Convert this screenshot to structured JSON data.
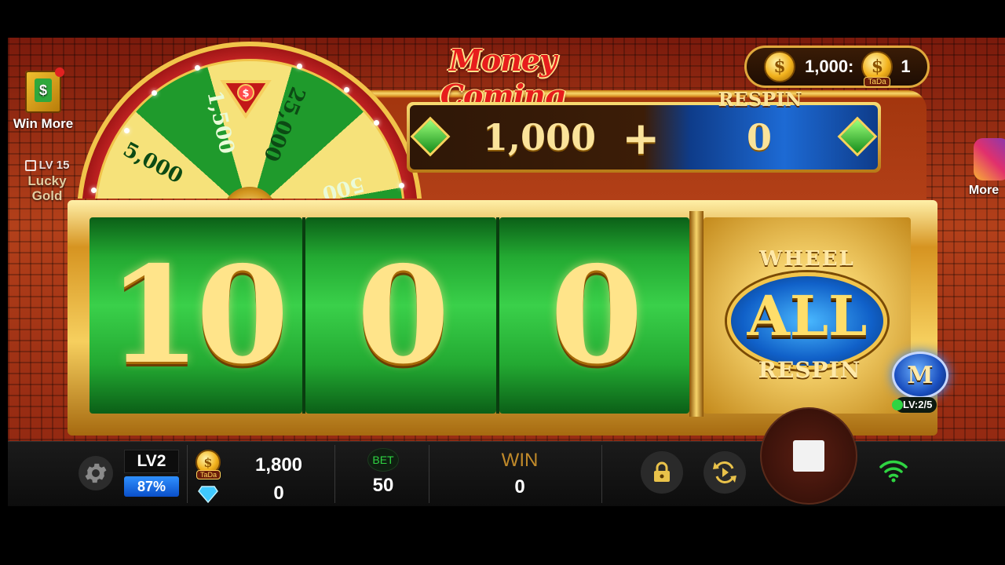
{
  "title": "Money Coming",
  "jackpot": {
    "value": "1,000:",
    "tada_label": "TaDa",
    "count": "1",
    "coin_symbol": "$"
  },
  "respin_panel": {
    "label": "RESPIN",
    "left_value": "1,000",
    "operator": "+",
    "right_value": "0"
  },
  "wheel": {
    "segments": [
      "5,000",
      "1,500",
      "25,000",
      "500"
    ],
    "pointer_symbol": "$"
  },
  "reels": [
    "10",
    "0",
    "0"
  ],
  "bonus": {
    "top": "WHEEL",
    "main": "ALL",
    "bottom": "RESPIN"
  },
  "side_left": {
    "win_more_label": "Win More",
    "lucky_level": "LV 15",
    "lucky_name": "Lucky Gold"
  },
  "side_right": {
    "more_label": "More"
  },
  "m_button": {
    "letter": "M",
    "level": "LV:2/5"
  },
  "bottom_bar": {
    "level": "LV2",
    "level_progress": "87%",
    "tada_label": "TaDa",
    "coin_balance": "1,800",
    "gem_balance": "0",
    "bet_label": "BET",
    "bet_value": "50",
    "win_label": "WIN",
    "win_value": "0"
  },
  "colors": {
    "reel_green": "#23a932",
    "gold": "#f6cf5e",
    "respin_blue": "#1d6ad4",
    "title_red": "#e71d1d",
    "progress_blue": "#2f90ff",
    "wifi_green": "#2fd442"
  }
}
